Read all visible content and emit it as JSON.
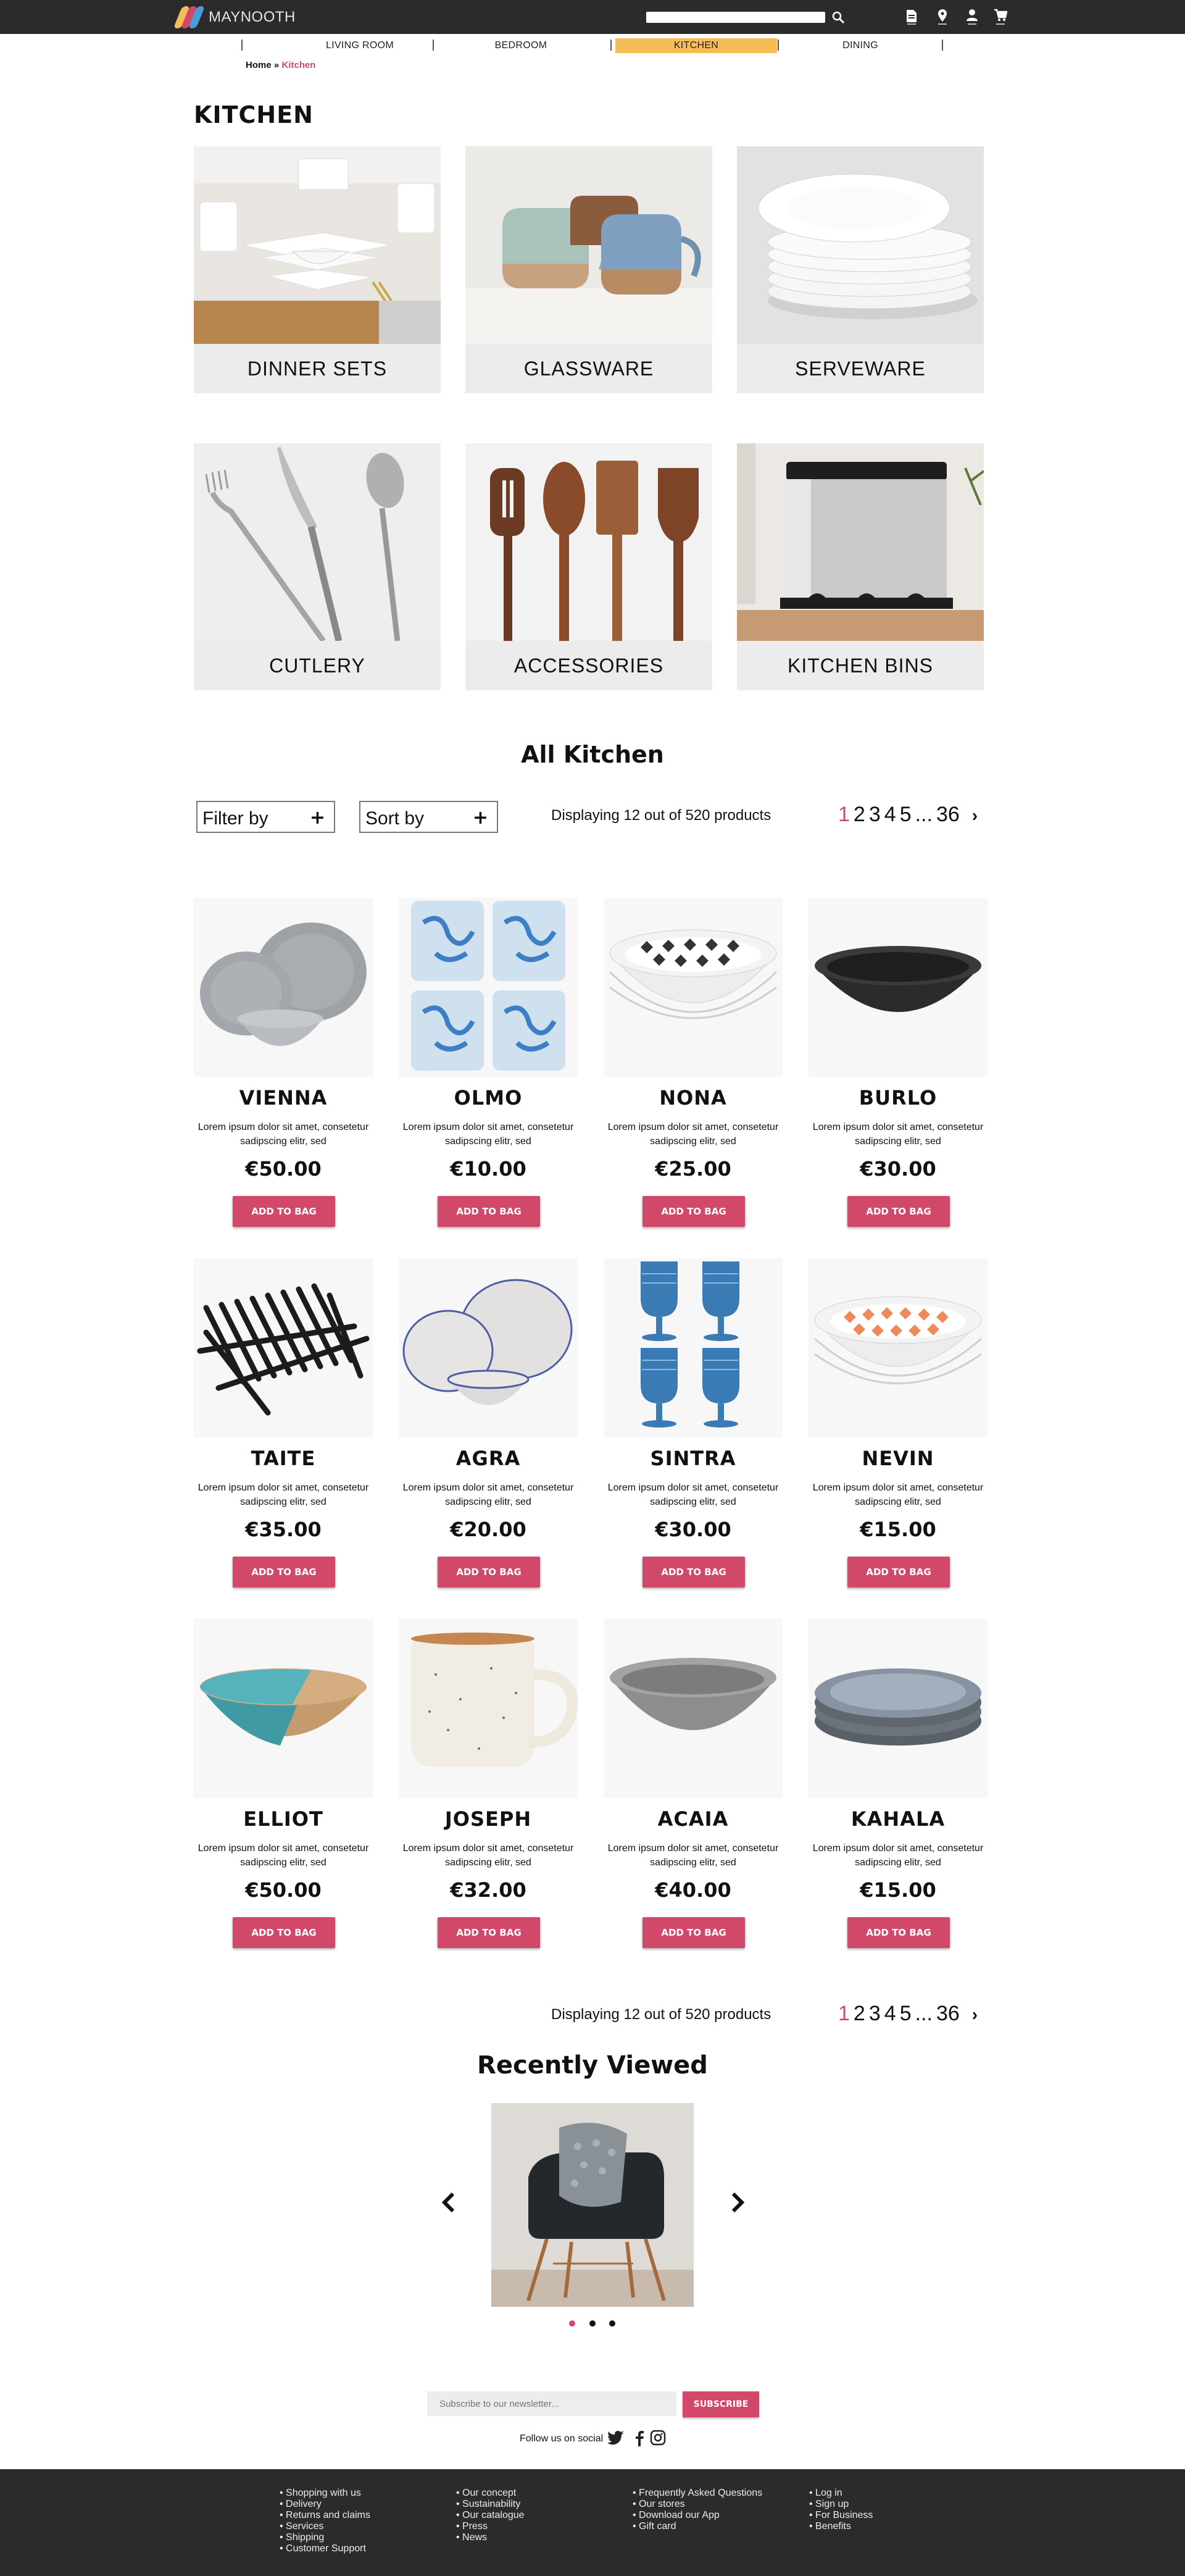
{
  "header": {
    "brand": "MAYNOOTH",
    "search_placeholder": "",
    "icons": [
      "search-icon",
      "document-icon",
      "location-icon",
      "user-icon",
      "cart-icon"
    ]
  },
  "nav": {
    "items": [
      {
        "label": "LIVING ROOM"
      },
      {
        "label": "BEDROOM"
      },
      {
        "label": "KITCHEN",
        "active": true
      },
      {
        "label": "DINING"
      }
    ]
  },
  "breadcrumb": {
    "home": "Home",
    "sep": " » ",
    "current": "Kitchen"
  },
  "page_title": "KITCHEN",
  "categories": [
    {
      "label": "DINNER SETS"
    },
    {
      "label": "GLASSWARE"
    },
    {
      "label": "SERVEWARE"
    },
    {
      "label": "CUTLERY"
    },
    {
      "label": "ACCESSORIES"
    },
    {
      "label": "KITCHEN BINS"
    }
  ],
  "listing": {
    "title": "All Kitchen",
    "filter_label": "Filter by",
    "sort_label": "Sort by",
    "plus": "+",
    "displaying": "Displaying 12 out of 520 products",
    "pages": [
      "1",
      "2",
      "3",
      "4",
      "5",
      "...",
      "36"
    ],
    "current_page": "1",
    "next": "›"
  },
  "products": [
    {
      "name": "VIENNA",
      "desc": "Lorem ipsum dolor sit amet, consetetur sadipscing elitr, sed",
      "price": "€50.00",
      "button": "ADD TO BAG"
    },
    {
      "name": "OLMO",
      "desc": "Lorem ipsum dolor sit amet, consetetur sadipscing elitr, sed",
      "price": "€10.00",
      "button": "ADD TO BAG"
    },
    {
      "name": "NONA",
      "desc": "Lorem ipsum dolor sit amet, consetetur sadipscing elitr, sed",
      "price": "€25.00",
      "button": "ADD TO BAG"
    },
    {
      "name": "BURLO",
      "desc": "Lorem ipsum dolor sit amet, consetetur sadipscing elitr, sed",
      "price": "€30.00",
      "button": "ADD TO BAG"
    },
    {
      "name": "TAITE",
      "desc": "Lorem ipsum dolor sit amet, consetetur sadipscing elitr, sed",
      "price": "€35.00",
      "button": "ADD TO BAG"
    },
    {
      "name": "AGRA",
      "desc": "Lorem ipsum dolor sit amet, consetetur sadipscing elitr, sed",
      "price": "€20.00",
      "button": "ADD TO BAG"
    },
    {
      "name": "SINTRA",
      "desc": "Lorem ipsum dolor sit amet, consetetur sadipscing elitr, sed",
      "price": "€30.00",
      "button": "ADD TO BAG"
    },
    {
      "name": "NEVIN",
      "desc": "Lorem ipsum dolor sit amet, consetetur sadipscing elitr, sed",
      "price": "€15.00",
      "button": "ADD TO BAG"
    },
    {
      "name": "ELLIOT",
      "desc": "Lorem ipsum dolor sit amet, consetetur sadipscing elitr, sed",
      "price": "€50.00",
      "button": "ADD TO BAG"
    },
    {
      "name": "JOSEPH",
      "desc": "Lorem ipsum dolor sit amet, consetetur sadipscing elitr, sed",
      "price": "€32.00",
      "button": "ADD TO BAG"
    },
    {
      "name": "ACAIA",
      "desc": "Lorem ipsum dolor sit amet, consetetur sadipscing elitr, sed",
      "price": "€40.00",
      "button": "ADD TO BAG"
    },
    {
      "name": "KAHALA",
      "desc": "Lorem ipsum dolor sit amet, consetetur sadipscing elitr, sed",
      "price": "€15.00",
      "button": "ADD TO BAG"
    }
  ],
  "recently_viewed": {
    "title": "Recently Viewed",
    "prev": "‹",
    "next": "›",
    "slide_count": 3,
    "active_slide": 1
  },
  "newsletter": {
    "placeholder": "Subscribe to our newsletter...",
    "button": "SUBSCRIBE",
    "follow": "Follow us on social",
    "social_icons": [
      "twitter-icon",
      "facebook-icon",
      "instagram-icon"
    ]
  },
  "footer": {
    "columns": [
      [
        "• Shopping with us",
        "• Delivery",
        "• Returns and claims",
        "• Services",
        "• Shipping",
        "• Customer Support"
      ],
      [
        "• Our concept",
        "• Sustainability",
        "• Our catalogue",
        "• Press",
        "• News"
      ],
      [
        "• Frequently Asked Questions",
        "• Our stores",
        "• Download our App",
        "• Gift card"
      ],
      [
        "• Log in",
        "• Sign up",
        "• For Business",
        "• Benefits"
      ]
    ]
  },
  "colors": {
    "accent": "#d14869",
    "nav_active": "#f4bd55",
    "dark": "#2b2b2b"
  }
}
